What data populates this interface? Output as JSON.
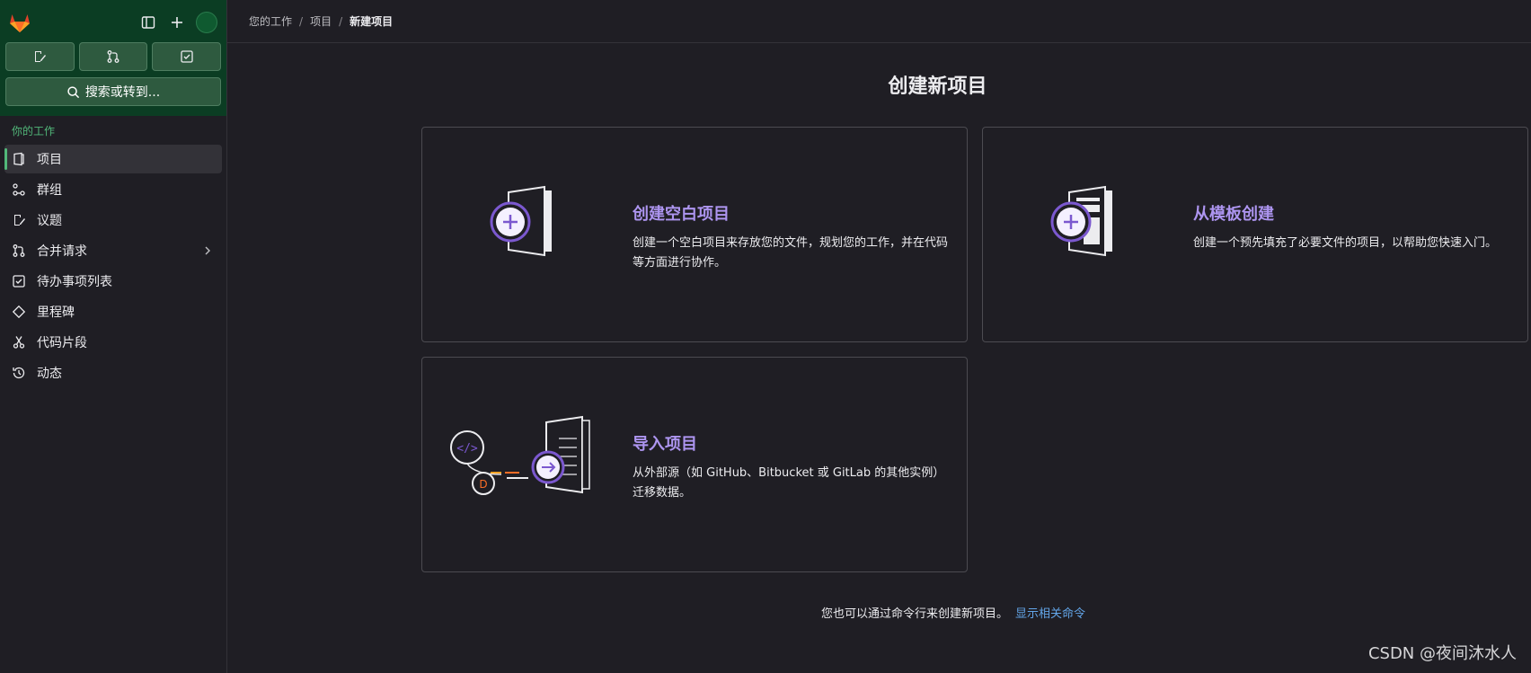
{
  "sidebar": {
    "search_label": "搜索或转到...",
    "section_label": "你的工作",
    "items": [
      {
        "label": "项目",
        "icon": "project-icon",
        "active": true
      },
      {
        "label": "群组",
        "icon": "group-icon"
      },
      {
        "label": "议题",
        "icon": "issues-icon"
      },
      {
        "label": "合并请求",
        "icon": "merge-request-icon",
        "has_children": true
      },
      {
        "label": "待办事项列表",
        "icon": "todo-icon"
      },
      {
        "label": "里程碑",
        "icon": "milestone-icon"
      },
      {
        "label": "代码片段",
        "icon": "snippet-icon"
      },
      {
        "label": "动态",
        "icon": "history-icon"
      }
    ]
  },
  "breadcrumb": {
    "items": [
      "您的工作",
      "项目",
      "新建项目"
    ]
  },
  "main": {
    "title": "创建新项目",
    "cards": [
      {
        "title": "创建空白项目",
        "description": "创建一个空白项目来存放您的文件，规划您的工作，并在代码等方面进行协作。"
      },
      {
        "title": "从模板创建",
        "description": "创建一个预先填充了必要文件的项目，以帮助您快速入门。"
      },
      {
        "title": "导入项目",
        "description": "从外部源（如 GitHub、Bitbucket 或 GitLab 的其他实例）迁移数据。"
      }
    ],
    "footer_text": "您也可以通过命令行来创建新项目。",
    "footer_link": "显示相关命令"
  },
  "watermark": "CSDN @夜间沐水人",
  "colors": {
    "sidebar_top": "#0b3d23",
    "accent": "#52b87a",
    "card_title": "#ad95f0",
    "link": "#63a6e9",
    "background": "#1f1e24"
  }
}
